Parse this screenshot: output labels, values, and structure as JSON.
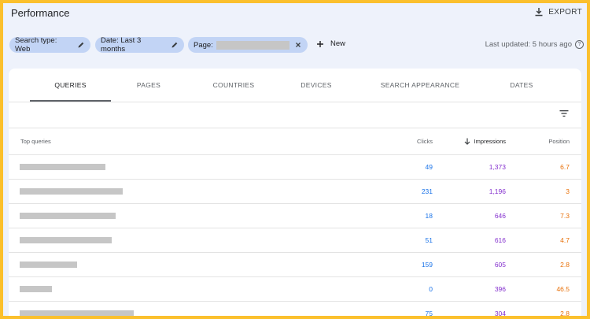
{
  "header": {
    "title": "Performance",
    "export_label": "EXPORT"
  },
  "filters": {
    "search_type": "Search type: Web",
    "date": "Date: Last 3 months",
    "page_label": "Page:",
    "new_label": "New",
    "last_updated": "Last updated: 5 hours ago"
  },
  "tabs": [
    "QUERIES",
    "PAGES",
    "COUNTRIES",
    "DEVICES",
    "SEARCH APPEARANCE",
    "DATES"
  ],
  "table": {
    "col_query": "Top queries",
    "col_clicks": "Clicks",
    "col_impressions": "Impressions",
    "col_position": "Position",
    "rows": [
      {
        "clicks": "49",
        "impressions": "1,373",
        "position": "6.7"
      },
      {
        "clicks": "231",
        "impressions": "1,196",
        "position": "3"
      },
      {
        "clicks": "18",
        "impressions": "646",
        "position": "7.3"
      },
      {
        "clicks": "51",
        "impressions": "616",
        "position": "4.7"
      },
      {
        "clicks": "159",
        "impressions": "605",
        "position": "2.8"
      },
      {
        "clicks": "0",
        "impressions": "396",
        "position": "46.5"
      },
      {
        "clicks": "75",
        "impressions": "304",
        "position": "2.8"
      }
    ]
  },
  "colors": {
    "clicks": "#1a73e8",
    "impressions": "#8430ce",
    "position": "#e8710a",
    "chip_bg": "#c2d4f5",
    "border": "#fbc02d"
  }
}
